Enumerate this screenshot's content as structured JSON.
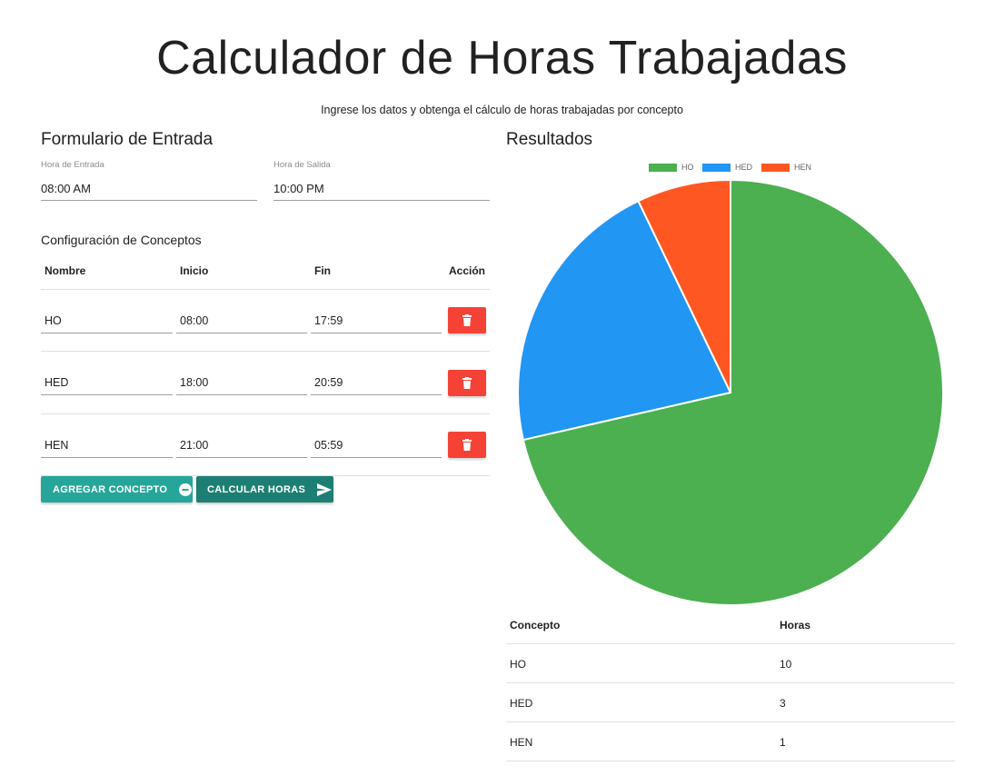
{
  "header": {
    "title": "Calculador de Horas Trabajadas",
    "subtitle": "Ingrese los datos y obtenga el cálculo de horas trabajadas por concepto"
  },
  "form": {
    "title": "Formulario de Entrada",
    "entry": {
      "label": "Hora de Entrada",
      "value": "08:00 AM"
    },
    "exit": {
      "label": "Hora de Salida",
      "value": "10:00 PM"
    },
    "concepts_title": "Configuración de Conceptos",
    "columns": [
      "Nombre",
      "Inicio",
      "Fin",
      "Acción"
    ],
    "rows": [
      {
        "name": "HO",
        "start": "08:00",
        "end": "17:59"
      },
      {
        "name": "HED",
        "start": "18:00",
        "end": "20:59"
      },
      {
        "name": "HEN",
        "start": "21:00",
        "end": "05:59"
      }
    ],
    "add_button": "AGREGAR CONCEPTO",
    "calc_button": "CALCULAR HORAS",
    "icons": {
      "delete": "trash-icon",
      "add": "add-circle-icon",
      "send": "send-icon"
    }
  },
  "results": {
    "title": "Resultados",
    "columns": [
      "Concepto",
      "Horas"
    ],
    "rows": [
      {
        "concept": "HO",
        "hours": "10"
      },
      {
        "concept": "HED",
        "hours": "3"
      },
      {
        "concept": "HEN",
        "hours": "1"
      }
    ]
  },
  "colors": {
    "teal": "#26a69a",
    "teal_dark": "#1d7f74",
    "red": "#f44336",
    "green": "#4caf50",
    "blue": "#2196f3",
    "orange": "#ff5722"
  },
  "chart_data": {
    "type": "pie",
    "categories": [
      "HO",
      "HED",
      "HEN"
    ],
    "values": [
      10,
      3,
      1
    ],
    "colors": [
      "#4caf50",
      "#2196f3",
      "#ff5722"
    ],
    "legend": "top"
  }
}
